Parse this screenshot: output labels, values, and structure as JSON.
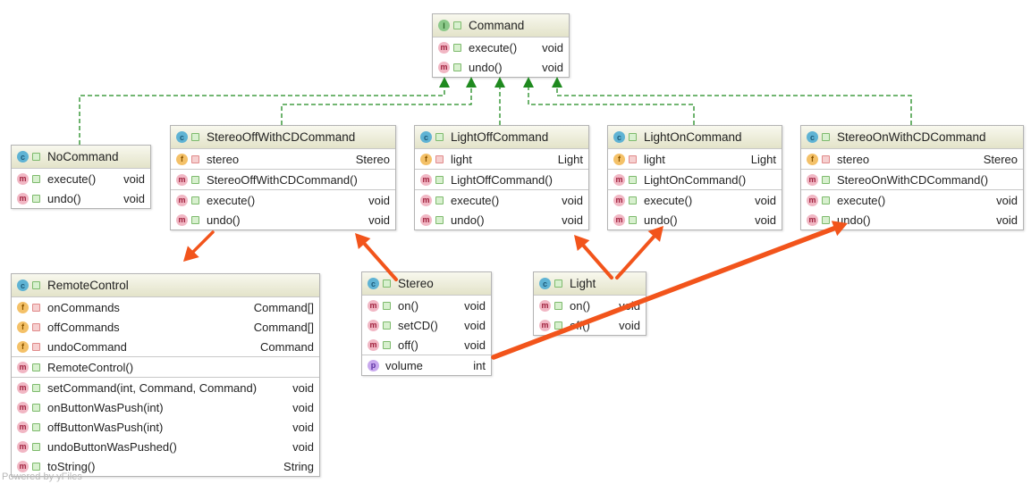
{
  "diagram": {
    "colors": {
      "inheritance": "#1f8a1f",
      "annotation_arrow": "#f2541b",
      "header_top": "#f8f8ee",
      "header_bottom": "#e3e3c9"
    },
    "classes": [
      {
        "id": "command",
        "kind": "I",
        "name": "Command",
        "sections": [
          [
            {
              "icon": "m",
              "vis": "public",
              "name": "execute()",
              "type": "void"
            },
            {
              "icon": "m",
              "vis": "public",
              "name": "undo()",
              "type": "void"
            }
          ]
        ]
      },
      {
        "id": "nocommand",
        "kind": "c",
        "name": "NoCommand",
        "sections": [
          [
            {
              "icon": "m",
              "vis": "public",
              "name": "execute()",
              "type": "void"
            },
            {
              "icon": "m",
              "vis": "public",
              "name": "undo()",
              "type": "void"
            }
          ]
        ]
      },
      {
        "id": "stereooff",
        "kind": "c",
        "name": "StereoOffWithCDCommand",
        "sections": [
          [
            {
              "icon": "f",
              "vis": "private",
              "name": "stereo",
              "type": "Stereo"
            }
          ],
          [
            {
              "icon": "m",
              "vis": "public",
              "name": "StereoOffWithCDCommand()",
              "type": ""
            }
          ],
          [
            {
              "icon": "m",
              "vis": "public",
              "name": "execute()",
              "type": "void"
            },
            {
              "icon": "m",
              "vis": "public",
              "name": "undo()",
              "type": "void"
            }
          ]
        ]
      },
      {
        "id": "lightoff",
        "kind": "c",
        "name": "LightOffCommand",
        "sections": [
          [
            {
              "icon": "f",
              "vis": "private",
              "name": "light",
              "type": "Light"
            }
          ],
          [
            {
              "icon": "m",
              "vis": "public",
              "name": "LightOffCommand()",
              "type": ""
            }
          ],
          [
            {
              "icon": "m",
              "vis": "public",
              "name": "execute()",
              "type": "void"
            },
            {
              "icon": "m",
              "vis": "public",
              "name": "undo()",
              "type": "void"
            }
          ]
        ]
      },
      {
        "id": "lighton",
        "kind": "c",
        "name": "LightOnCommand",
        "sections": [
          [
            {
              "icon": "f",
              "vis": "private",
              "name": "light",
              "type": "Light"
            }
          ],
          [
            {
              "icon": "m",
              "vis": "public",
              "name": "LightOnCommand()",
              "type": ""
            }
          ],
          [
            {
              "icon": "m",
              "vis": "public",
              "name": "execute()",
              "type": "void"
            },
            {
              "icon": "m",
              "vis": "public",
              "name": "undo()",
              "type": "void"
            }
          ]
        ]
      },
      {
        "id": "stereoon",
        "kind": "c",
        "name": "StereoOnWithCDCommand",
        "sections": [
          [
            {
              "icon": "f",
              "vis": "private",
              "name": "stereo",
              "type": "Stereo"
            }
          ],
          [
            {
              "icon": "m",
              "vis": "public",
              "name": "StereoOnWithCDCommand()",
              "type": ""
            }
          ],
          [
            {
              "icon": "m",
              "vis": "public",
              "name": "execute()",
              "type": "void"
            },
            {
              "icon": "m",
              "vis": "public",
              "name": "undo()",
              "type": "void"
            }
          ]
        ]
      },
      {
        "id": "remotecontrol",
        "kind": "c",
        "name": "RemoteControl",
        "sections": [
          [
            {
              "icon": "f",
              "vis": "private",
              "name": "onCommands",
              "type": "Command[]"
            },
            {
              "icon": "f",
              "vis": "private",
              "name": "offCommands",
              "type": "Command[]"
            },
            {
              "icon": "f",
              "vis": "private",
              "name": "undoCommand",
              "type": "Command"
            }
          ],
          [
            {
              "icon": "m",
              "vis": "public",
              "name": "RemoteControl()",
              "type": ""
            }
          ],
          [
            {
              "icon": "m",
              "vis": "public",
              "name": "setCommand(int, Command, Command)",
              "type": "void"
            },
            {
              "icon": "m",
              "vis": "public",
              "name": "onButtonWasPush(int)",
              "type": "void"
            },
            {
              "icon": "m",
              "vis": "public",
              "name": "offButtonWasPush(int)",
              "type": "void"
            },
            {
              "icon": "m",
              "vis": "public",
              "name": "undoButtonWasPushed()",
              "type": "void"
            },
            {
              "icon": "m",
              "vis": "public",
              "name": "toString()",
              "type": "String"
            }
          ]
        ]
      },
      {
        "id": "stereo",
        "kind": "c",
        "name": "Stereo",
        "sections": [
          [
            {
              "icon": "m",
              "vis": "public",
              "name": "on()",
              "type": "void"
            },
            {
              "icon": "m",
              "vis": "public",
              "name": "setCD()",
              "type": "void"
            },
            {
              "icon": "m",
              "vis": "public",
              "name": "off()",
              "type": "void"
            }
          ],
          [
            {
              "icon": "p",
              "vis": "none",
              "name": "volume",
              "type": "int"
            }
          ]
        ]
      },
      {
        "id": "light",
        "kind": "c",
        "name": "Light",
        "sections": [
          [
            {
              "icon": "m",
              "vis": "public",
              "name": "on()",
              "type": "void"
            },
            {
              "icon": "m",
              "vis": "public",
              "name": "off()",
              "type": "void"
            }
          ]
        ]
      }
    ],
    "implements": [
      {
        "from": "nocommand",
        "to": "command"
      },
      {
        "from": "stereooff",
        "to": "command"
      },
      {
        "from": "lightoff",
        "to": "command"
      },
      {
        "from": "lighton",
        "to": "command"
      },
      {
        "from": "stereoon",
        "to": "command"
      }
    ],
    "footer": "Powered by yFiles"
  }
}
